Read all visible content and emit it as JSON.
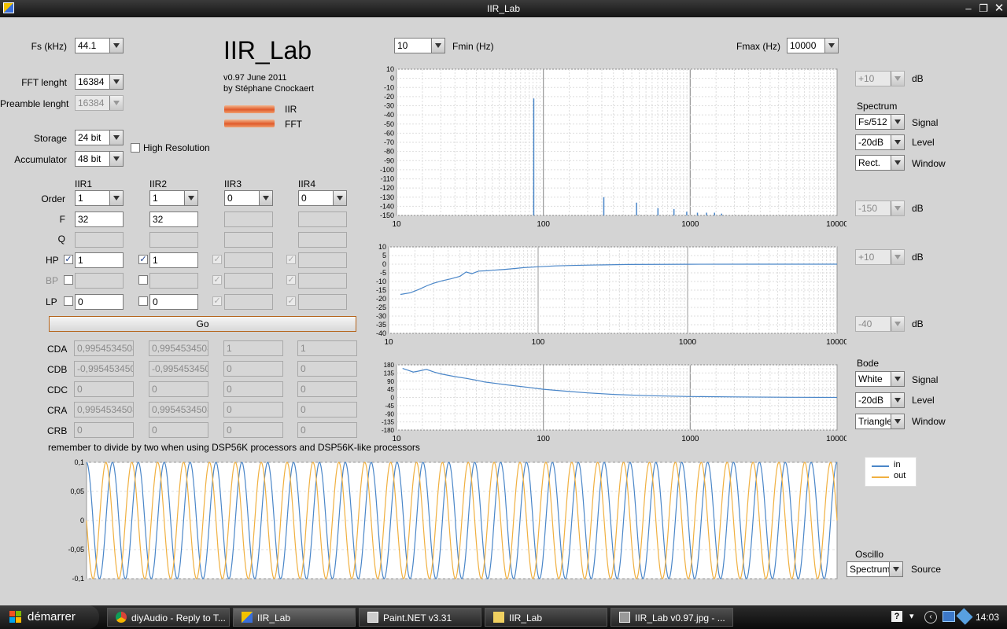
{
  "window": {
    "title": "IIR_Lab"
  },
  "header": {
    "app_name": "IIR_Lab",
    "version": "v0.97 June 2011",
    "author": "by Stéphane Cnockaert",
    "led_iir": "IIR",
    "led_fft": "FFT"
  },
  "settings": {
    "fs_label": "Fs (kHz)",
    "fs_value": "44.1",
    "fft_label": "FFT lenght",
    "fft_value": "16384",
    "preamble_label": "Preamble lenght",
    "preamble_value": "16384",
    "storage_label": "Storage",
    "storage_value": "24 bit",
    "accumulator_label": "Accumulator",
    "accumulator_value": "48 bit",
    "high_res_label": "High Resolution"
  },
  "filters": {
    "headers": [
      "IIR1",
      "IIR2",
      "IIR3",
      "IIR4"
    ],
    "row_labels": {
      "order": "Order",
      "f": "F",
      "q": "Q",
      "hp": "HP",
      "bp": "BP",
      "lp": "LP"
    },
    "order": [
      "1",
      "1",
      "0",
      "0"
    ],
    "f": [
      "32",
      "32",
      "",
      ""
    ],
    "q": [
      "",
      "",
      "",
      ""
    ],
    "hp": [
      "1",
      "1",
      "",
      ""
    ],
    "bp": [
      "",
      "",
      "",
      ""
    ],
    "lp": [
      "0",
      "0",
      "",
      ""
    ]
  },
  "go_label": "Go",
  "coefficients": {
    "labels": [
      "CDA",
      "CDB",
      "CDC",
      "CRA",
      "CRB"
    ],
    "values": [
      [
        "0,9954534508",
        "0,9954534508",
        "1",
        "1"
      ],
      [
        "-0,995453450",
        "-0,995453450",
        "0",
        "0"
      ],
      [
        "0",
        "0",
        "0",
        "0"
      ],
      [
        "0,9954534508",
        "0,9954534508",
        "0",
        "0"
      ],
      [
        "0",
        "0",
        "0",
        "0"
      ]
    ]
  },
  "note": "remember to divide by two when using DSP56K processors and DSP56K-like processors",
  "freq": {
    "fmin_label": "Fmin (Hz)",
    "fmin_value": "10",
    "fmax_label": "Fmax (Hz)",
    "fmax_value": "10000"
  },
  "right_panel": {
    "db_label": "dB",
    "spectrum_top": "+10",
    "spectrum_bottom": "-150",
    "spectrum_title": "Spectrum",
    "spectrum_signal": "Fs/512",
    "spectrum_level": "-20dB",
    "spectrum_window": "Rect.",
    "signal_label": "Signal",
    "level_label": "Level",
    "window_label": "Window",
    "bode_top": "+10",
    "bode_bottom": "-40",
    "bode_title": "Bode",
    "bode_signal": "White",
    "bode_level": "-20dB",
    "bode_window": "Triangle",
    "oscillo_title": "Oscillo",
    "oscillo_source": "Spectrum",
    "source_label": "Source",
    "legend_in": "in",
    "legend_out": "out"
  },
  "colors": {
    "in": "#4a86c8",
    "out": "#f0b040",
    "spectrum": "#4a86c8"
  },
  "chart_data": [
    {
      "type": "bar",
      "name": "spectrum",
      "x_scale": "log",
      "xlim": [
        10,
        10000
      ],
      "ylim": [
        -150,
        10
      ],
      "x_ticks": [
        "10",
        "100",
        "1000",
        "10000"
      ],
      "y_ticks": [
        "10",
        "0",
        "-10",
        "-20",
        "-30",
        "-40",
        "-50",
        "-60",
        "-70",
        "-80",
        "-90",
        "-100",
        "-110",
        "-120",
        "-130",
        "-140",
        "-150"
      ],
      "x": [
        86,
        258,
        431,
        603,
        775,
        947,
        1120,
        1292,
        1464,
        1636
      ],
      "values": [
        -22,
        -130,
        -136,
        -142,
        -143,
        -146,
        -147,
        -147,
        -147,
        -148
      ]
    },
    {
      "type": "line",
      "name": "bode-magnitude",
      "x_scale": "log",
      "xlim": [
        10,
        10000
      ],
      "ylim": [
        -40,
        10
      ],
      "x_ticks": [
        "10",
        "100",
        "1000",
        "10000"
      ],
      "y_ticks": [
        "10",
        "5",
        "0",
        "-5",
        "-10",
        "-15",
        "-20",
        "-25",
        "-30",
        "-35",
        "-40"
      ],
      "x": [
        12,
        14,
        16,
        18,
        20,
        23,
        26,
        30,
        33,
        36,
        40,
        45,
        50,
        60,
        70,
        80,
        100,
        130,
        200,
        400,
        1000,
        3000,
        10000
      ],
      "y": [
        -17.5,
        -16.5,
        -14.5,
        -12.5,
        -11,
        -9.5,
        -8.5,
        -7,
        -4.5,
        -5.5,
        -4,
        -3.8,
        -3.5,
        -3,
        -2.5,
        -2,
        -1.5,
        -1,
        -0.6,
        -0.2,
        -0.05,
        0,
        0
      ]
    },
    {
      "type": "line",
      "name": "bode-phase",
      "x_scale": "log",
      "xlim": [
        10,
        10000
      ],
      "ylim": [
        -180,
        180
      ],
      "x_ticks": [
        "10",
        "100",
        "1000",
        "10000"
      ],
      "y_ticks": [
        "180",
        "135",
        "90",
        "45",
        "0",
        "-45",
        "-90",
        "-135",
        "-180"
      ],
      "x": [
        11,
        12,
        13,
        14,
        16,
        18,
        20,
        25,
        30,
        35,
        40,
        50,
        60,
        80,
        100,
        150,
        200,
        300,
        500,
        1000,
        2000,
        5000,
        10000
      ],
      "y": [
        160,
        150,
        140,
        145,
        155,
        140,
        130,
        115,
        105,
        95,
        85,
        75,
        67,
        55,
        45,
        33,
        25,
        17,
        10,
        5,
        3,
        1,
        0
      ]
    },
    {
      "type": "line",
      "name": "oscillo",
      "ylim": [
        -0.1,
        0.1
      ],
      "y_ticks": [
        "0,1",
        "0,05",
        "0",
        "-0,05",
        "-0,1"
      ],
      "cycles": 29,
      "series": [
        {
          "name": "in",
          "amplitude": 0.1,
          "phase_deg": 0
        },
        {
          "name": "out",
          "amplitude": 0.1,
          "phase_deg": 90
        }
      ]
    }
  ],
  "taskbar": {
    "start_label": "démarrer",
    "items": [
      "diyAudio - Reply to T...",
      "IIR_Lab",
      "Paint.NET v3.31",
      "IIR_Lab",
      "IIR_Lab v0.97.jpg - ..."
    ],
    "clock": "14:03"
  }
}
